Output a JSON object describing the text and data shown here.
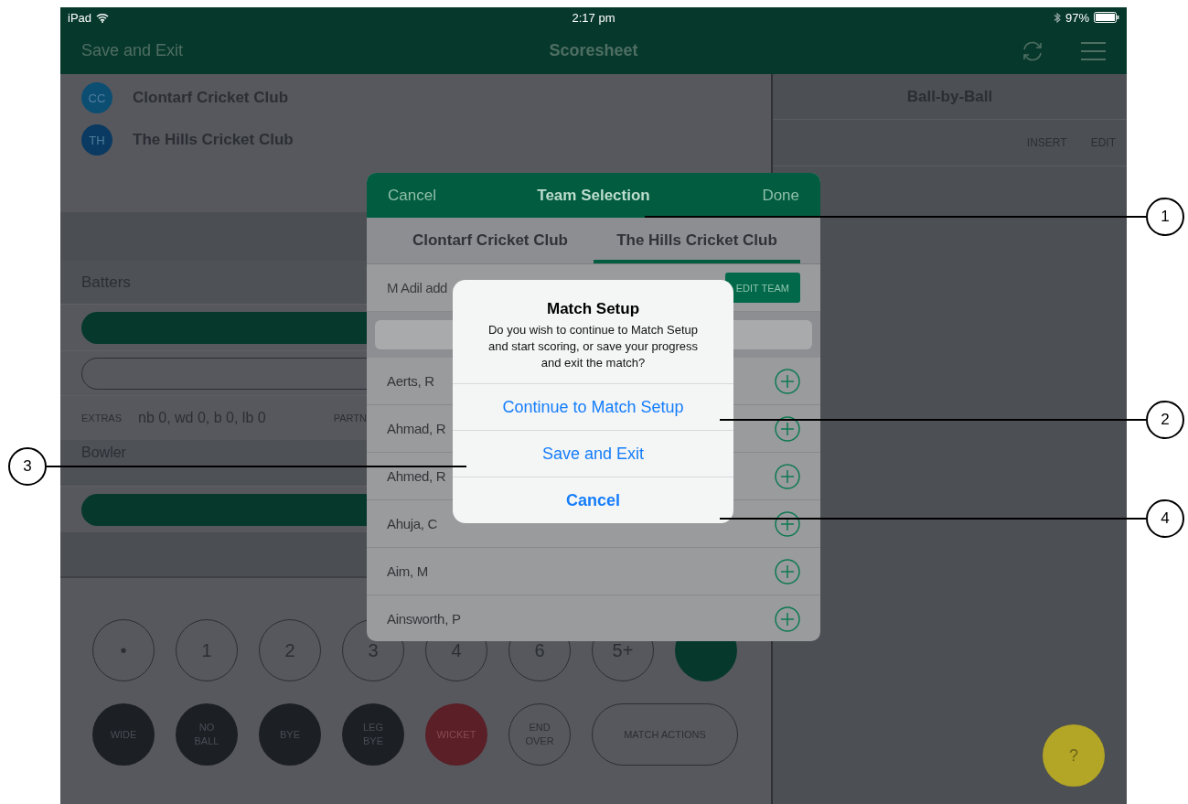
{
  "status_bar": {
    "carrier": "iPad",
    "time": "2:17 pm",
    "battery": "97%"
  },
  "nav_bar": {
    "left": "Save and Exit",
    "title": "Scoresheet"
  },
  "teams": [
    {
      "initials": "CC",
      "name": "Clontarf Cricket Club",
      "color": "#0c4e72"
    },
    {
      "initials": "TH",
      "name": "The Hills Cricket Club",
      "color": "#0a3a62"
    }
  ],
  "batters": {
    "title": "Batters"
  },
  "extras": {
    "label": "EXTRAS",
    "value": "nb 0, wd 0, b 0, lb 0",
    "partnership_label": "PARTN"
  },
  "bowler": {
    "title": "Bowler"
  },
  "run_buttons": [
    {
      "label": "•",
      "kind": "outline"
    },
    {
      "label": "1",
      "kind": "outline"
    },
    {
      "label": "2",
      "kind": "outline"
    },
    {
      "label": "3",
      "kind": "outline"
    },
    {
      "label": "4",
      "kind": "outline"
    },
    {
      "label": "6",
      "kind": "outline"
    },
    {
      "label": "5+",
      "kind": "outline"
    },
    {
      "kind": "filled"
    }
  ],
  "extra_buttons": [
    {
      "label": "WIDE",
      "kind": "dark"
    },
    {
      "label": "NO BALL",
      "kind": "dark"
    },
    {
      "label": "BYE",
      "kind": "dark"
    },
    {
      "label": "LEG BYE",
      "kind": "dark"
    },
    {
      "label": "WICKET",
      "kind": "danger"
    },
    {
      "label": "END OVER",
      "kind": "outline"
    },
    {
      "label": "MATCH ACTIONS",
      "kind": "pill"
    }
  ],
  "ball_by_ball": {
    "title": "Ball-by-Ball",
    "actions": [
      "INSERT",
      "EDIT"
    ]
  },
  "help_button": {
    "label": "?"
  },
  "team_selection": {
    "cancel": "Cancel",
    "title": "Team Selection",
    "done": "Done",
    "tabs": [
      {
        "label": "Clontarf Cricket Club",
        "selected": false
      },
      {
        "label": "The Hills Cricket Club",
        "selected": true
      }
    ],
    "info": "M Adil add",
    "edit_button": "EDIT TEAM",
    "players": [
      "Aerts, R",
      "Ahmad, R",
      "Ahmed, R",
      "Ahuja, C",
      "Aim, M",
      "Ainsworth, P"
    ]
  },
  "alert": {
    "title": "Match Setup",
    "message": "Do you wish to continue to Match Setup and start scoring, or save your progress and exit the match?",
    "actions": [
      {
        "label": "Continue to Match Setup",
        "kind": "default"
      },
      {
        "label": "Save and Exit",
        "kind": "default"
      },
      {
        "label": "Cancel",
        "kind": "cancel"
      }
    ]
  },
  "callouts": [
    {
      "number": "1"
    },
    {
      "number": "2"
    },
    {
      "number": "3"
    },
    {
      "number": "4"
    }
  ]
}
